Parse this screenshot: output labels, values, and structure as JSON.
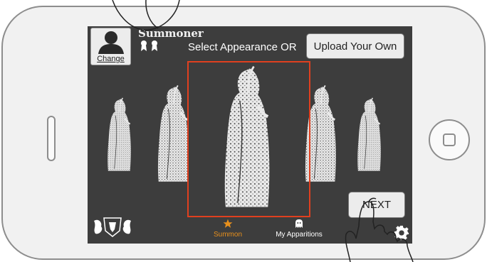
{
  "header": {
    "change_label": "Change",
    "user_name": "Summoner",
    "select_text": "Select Appearance OR",
    "upload_label": "Upload Your Own"
  },
  "carousel": {
    "selected_index": 2,
    "figure_count": 5
  },
  "actions": {
    "next_label": "NEXT"
  },
  "tabbar": {
    "tabs": [
      {
        "label": "Summon",
        "icon": "star-icon",
        "active": true
      },
      {
        "label": "My Apparitions",
        "icon": "ghost-icon",
        "active": false
      }
    ]
  },
  "colors": {
    "screen": "#3d3d3d",
    "selection": "#e0401f",
    "active_tab": "#e8901c"
  }
}
